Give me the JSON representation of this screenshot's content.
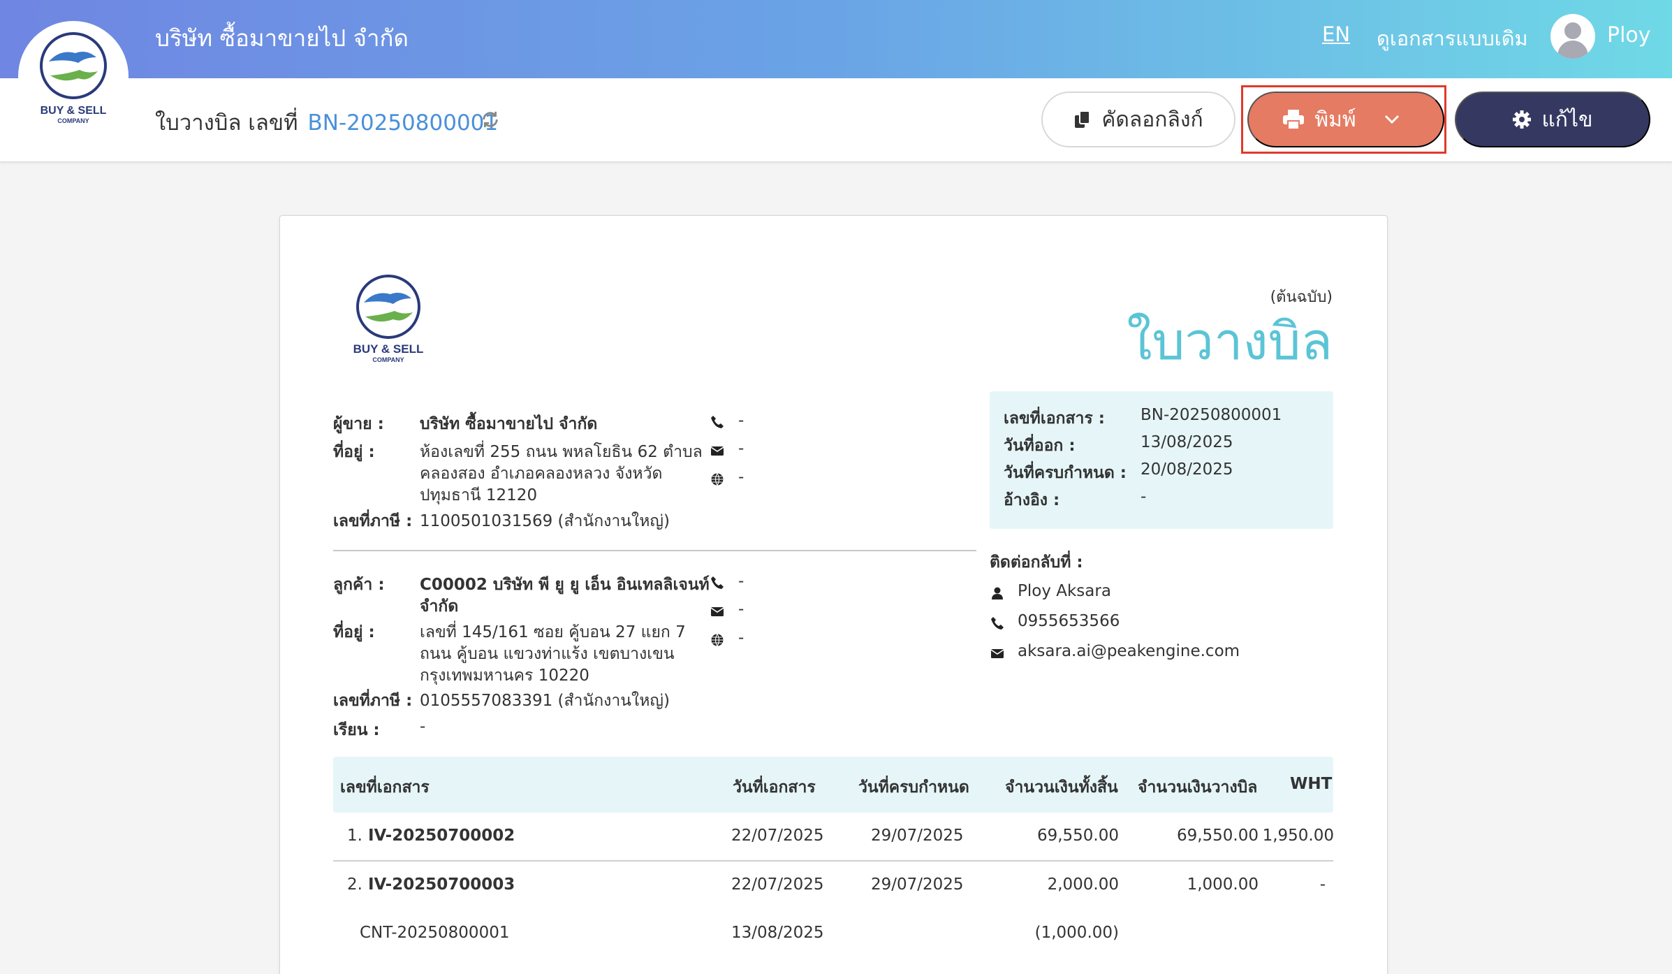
{
  "app": {
    "company_name": "บริษัท ซื้อมาขายไป จำกัด",
    "lang": "EN",
    "old_docs_link": "ดูเอกสารแบบเดิม",
    "user_name": "Ploy",
    "logo_text": "BUY & SELL",
    "logo_subtext": "COMPANY"
  },
  "toolbar": {
    "doc_title": "ใบวางบิล เลขที่",
    "doc_number": "BN-20250800001",
    "copy_link": "คัดลอกลิงก์",
    "print": "พิมพ์",
    "edit": "แก้ไข"
  },
  "document": {
    "copy_label": "(ต้นฉบับ)",
    "title": "ใบวางบิล",
    "seller": {
      "label_name": "ผู้ขาย :",
      "name": "บริษัท ซื้อมาขายไป จำกัด",
      "label_address": "ที่อยู่ :",
      "address_lines": [
        "ห้องเลขที่ 255 ถนน พหลโยธิน 62 ตำบล",
        "คลองสอง อำเภอคลองหลวง จังหวัด",
        "ปทุมธานี 12120"
      ],
      "label_tax": "เลขที่ภาษี :",
      "tax_id": "1100501031569 (สำนักงานใหญ่)",
      "phone": "-",
      "email": "-",
      "web": "-"
    },
    "customer": {
      "label_name": "ลูกค้า :",
      "name_lines": [
        "C00002 บริษัท พี ยู ยู เอ็น อินเทลลิเจนท์",
        "จำกัด"
      ],
      "label_address": "ที่อยู่ :",
      "address_lines": [
        "เลขที่ 145/161    ซอย คู้บอน 27 แยก 7",
        "ถนน คู้บอน  แขวงท่าแร้ง เขตบางเขน",
        "กรุงเทพมหานคร 10220"
      ],
      "label_tax": "เลขที่ภาษี :",
      "tax_id": "0105557083391 (สำนักงานใหญ่)",
      "label_attn": "เรียน :",
      "attn": "-",
      "phone": "-",
      "email": "-",
      "web": "-"
    },
    "info": {
      "doc_no_label": "เลขที่เอกสาร :",
      "doc_no": "BN-20250800001",
      "issue_label": "วันที่ออก :",
      "issue_date": "13/08/2025",
      "due_label": "วันที่ครบกำหนด :",
      "due_date": "20/08/2025",
      "ref_label": "อ้างอิง :",
      "ref": "-"
    },
    "contact": {
      "heading": "ติดต่อกลับที่ :",
      "name": "Ploy Aksara",
      "phone": "0955653566",
      "email": "aksara.ai@peakengine.com"
    },
    "table": {
      "headers": [
        "เลขที่เอกสาร",
        "วันที่เอกสาร",
        "วันที่ครบกำหนด",
        "จำนวนเงินทั้งสิ้น",
        "จำนวนเงินวางบิล",
        "WHT"
      ],
      "rows": [
        {
          "idx": "1.",
          "doc": "IV-20250700002",
          "date": "22/07/2025",
          "due": "29/07/2025",
          "total": "69,550.00",
          "billed": "69,550.00",
          "wht": "1,950.00"
        },
        {
          "idx": "2.",
          "doc": "IV-20250700003",
          "date": "22/07/2025",
          "due": "29/07/2025",
          "total": "2,000.00",
          "billed": "1,000.00",
          "wht": "-"
        }
      ],
      "sub_row": {
        "doc": "CNT-20250800001",
        "date": "13/08/2025",
        "total": "(1,000.00)"
      }
    }
  },
  "colors": {
    "accent_blue": "#4a90d9",
    "title_teal": "#5bc4d6",
    "print_button": "#e57b62",
    "edit_button": "#353962",
    "highlight": "#e0392c"
  }
}
